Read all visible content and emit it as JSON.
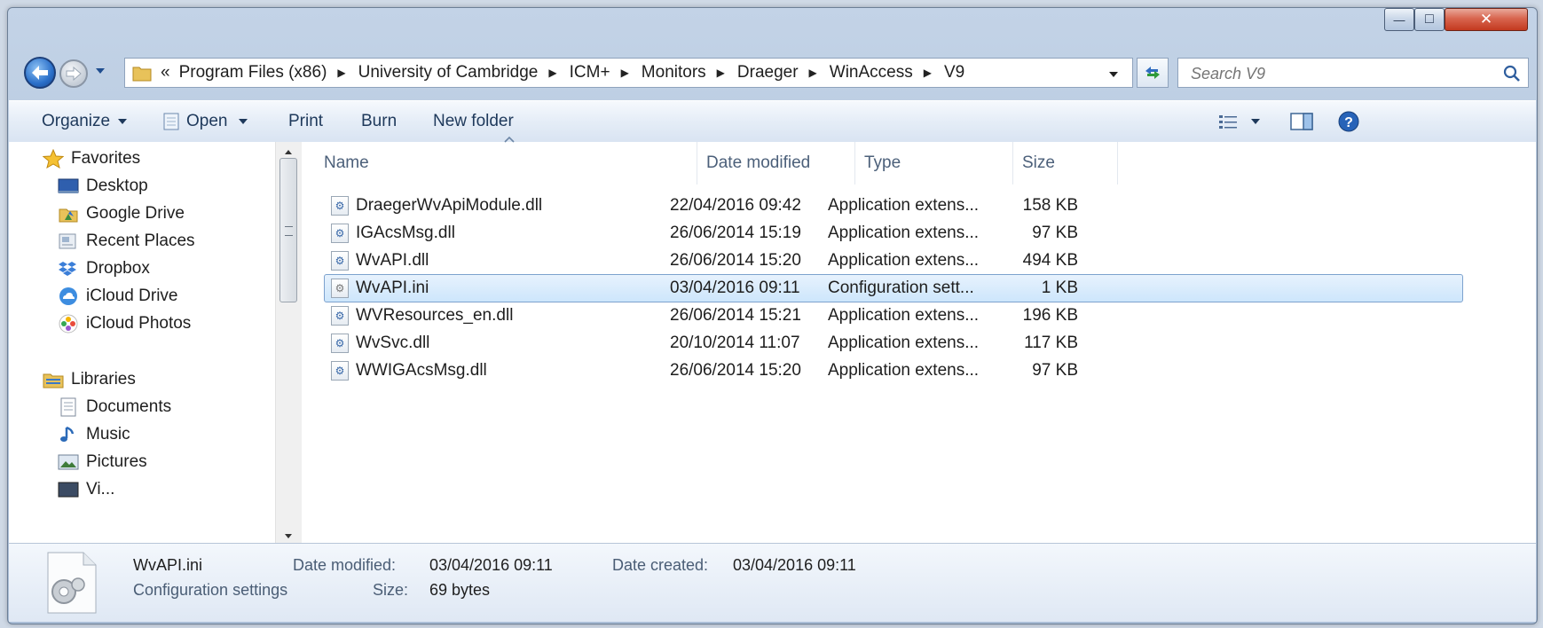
{
  "window": {
    "minimize_glyph": "—",
    "maximize_glyph": "□",
    "close_glyph": "✕"
  },
  "address_bar": {
    "overflow": "«",
    "crumbs": [
      "Program Files (x86)",
      "University of Cambridge",
      "ICM+",
      "Monitors",
      "Draeger",
      "WinAccess",
      "V9"
    ]
  },
  "search": {
    "placeholder": "Search V9"
  },
  "toolbar": {
    "organize": "Organize",
    "open": "Open",
    "print": "Print",
    "burn": "Burn",
    "new_folder": "New folder"
  },
  "nav_pane": {
    "favorites_header": "Favorites",
    "favorites": [
      {
        "label": "Desktop",
        "icon": "desktop-icon"
      },
      {
        "label": "Google Drive",
        "icon": "google-drive-icon"
      },
      {
        "label": "Recent Places",
        "icon": "recent-places-icon"
      },
      {
        "label": "Dropbox",
        "icon": "dropbox-icon"
      },
      {
        "label": "iCloud Drive",
        "icon": "icloud-icon"
      },
      {
        "label": "iCloud Photos",
        "icon": "icloud-photos-icon"
      }
    ],
    "libraries_header": "Libraries",
    "libraries": [
      {
        "label": "Documents",
        "icon": "documents-icon"
      },
      {
        "label": "Music",
        "icon": "music-icon"
      },
      {
        "label": "Pictures",
        "icon": "pictures-icon"
      },
      {
        "label": "Vi...",
        "icon": "videos-icon"
      }
    ]
  },
  "columns": {
    "name": "Name",
    "date": "Date modified",
    "type": "Type",
    "size": "Size"
  },
  "files": [
    {
      "name": "DraegerWvApiModule.dll",
      "date": "22/04/2016 09:42",
      "type": "Application extens...",
      "size": "158 KB",
      "selected": false
    },
    {
      "name": "IGAcsMsg.dll",
      "date": "26/06/2014 15:19",
      "type": "Application extens...",
      "size": "97 KB",
      "selected": false
    },
    {
      "name": "WvAPI.dll",
      "date": "26/06/2014 15:20",
      "type": "Application extens...",
      "size": "494 KB",
      "selected": false
    },
    {
      "name": "WvAPI.ini",
      "date": "03/04/2016 09:11",
      "type": "Configuration sett...",
      "size": "1 KB",
      "selected": true
    },
    {
      "name": "WVResources_en.dll",
      "date": "26/06/2014 15:21",
      "type": "Application extens...",
      "size": "196 KB",
      "selected": false
    },
    {
      "name": "WvSvc.dll",
      "date": "20/10/2014 11:07",
      "type": "Application extens...",
      "size": "117 KB",
      "selected": false
    },
    {
      "name": "WWIGAcsMsg.dll",
      "date": "26/06/2014 15:20",
      "type": "Application extens...",
      "size": "97 KB",
      "selected": false
    }
  ],
  "details": {
    "filename": "WvAPI.ini",
    "filetype": "Configuration settings",
    "date_modified_label": "Date modified:",
    "date_modified": "03/04/2016 09:11",
    "size_label": "Size:",
    "size": "69 bytes",
    "date_created_label": "Date created:",
    "date_created": "03/04/2016 09:11"
  }
}
